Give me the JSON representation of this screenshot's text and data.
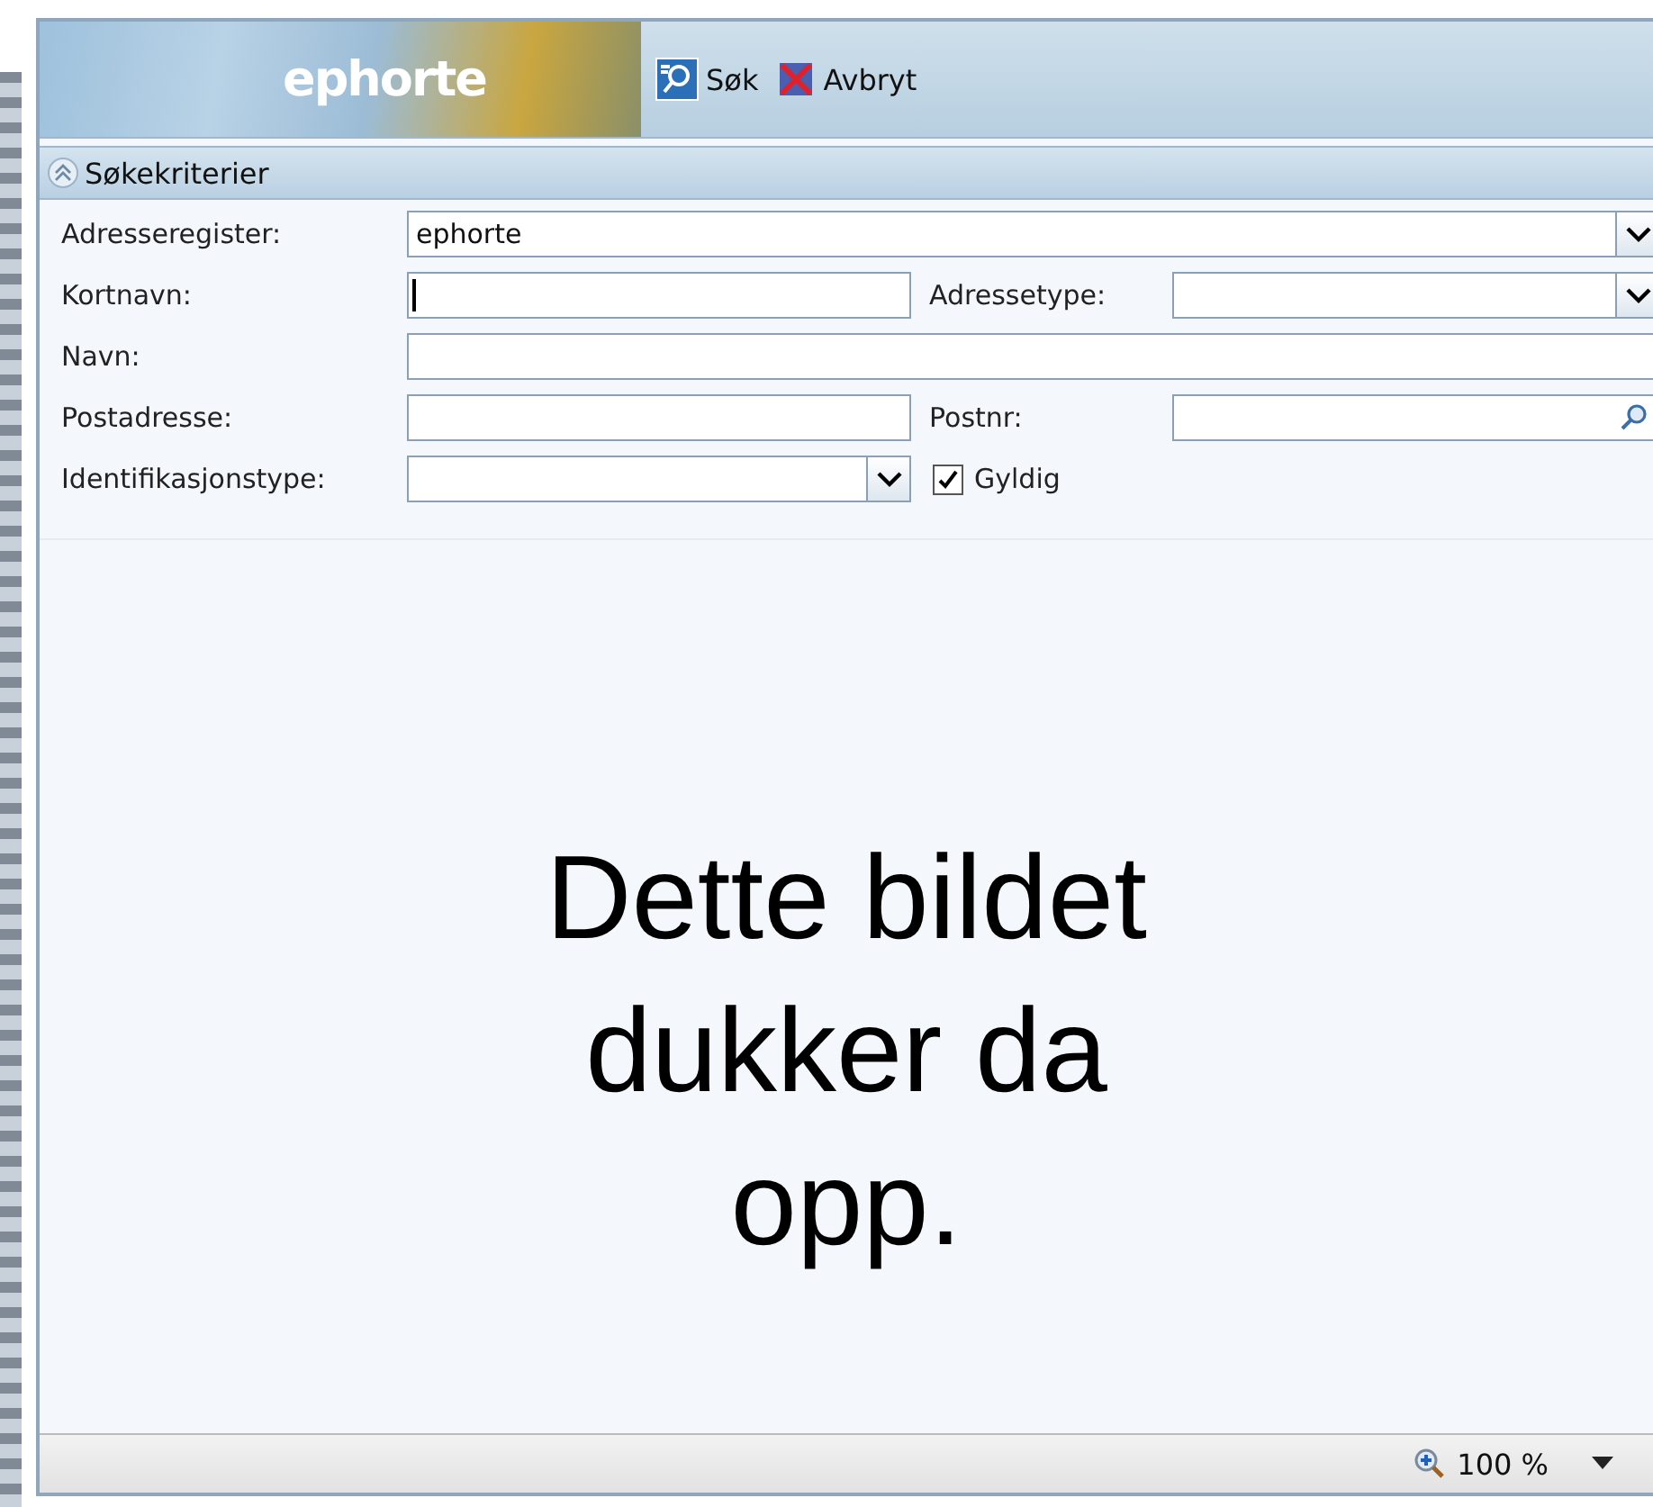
{
  "header": {
    "logo": "ephorte",
    "toolbar": [
      {
        "label": "Søk",
        "kind": "search"
      },
      {
        "label": "Avbryt",
        "kind": "cancel"
      }
    ]
  },
  "section": {
    "title": "Søkekriterier",
    "expanded": true
  },
  "form": {
    "rows": [
      {
        "fields": [
          {
            "label": "Adresseregister:",
            "kind": "dropdown",
            "value": "ephorte"
          }
        ]
      },
      {
        "fields": [
          {
            "label": "Kortnavn:",
            "kind": "text",
            "focused": true
          },
          {
            "label": "Adressetype:",
            "kind": "dropdown"
          }
        ]
      },
      {
        "fields": [
          {
            "label": "Navn:",
            "kind": "text"
          }
        ]
      },
      {
        "fields": [
          {
            "label": "Postadresse:",
            "kind": "text"
          },
          {
            "label": "Postnr:",
            "kind": "lookup"
          }
        ]
      },
      {
        "fields": [
          {
            "label": "Identifikasjonstype:",
            "kind": "dropdown"
          },
          {
            "label": "Gyldig",
            "kind": "checkbox",
            "checked": true
          }
        ]
      }
    ]
  },
  "overlay_text": "Dette bildet dukker da opp.",
  "status_bar": {
    "zoom": "100 %"
  }
}
